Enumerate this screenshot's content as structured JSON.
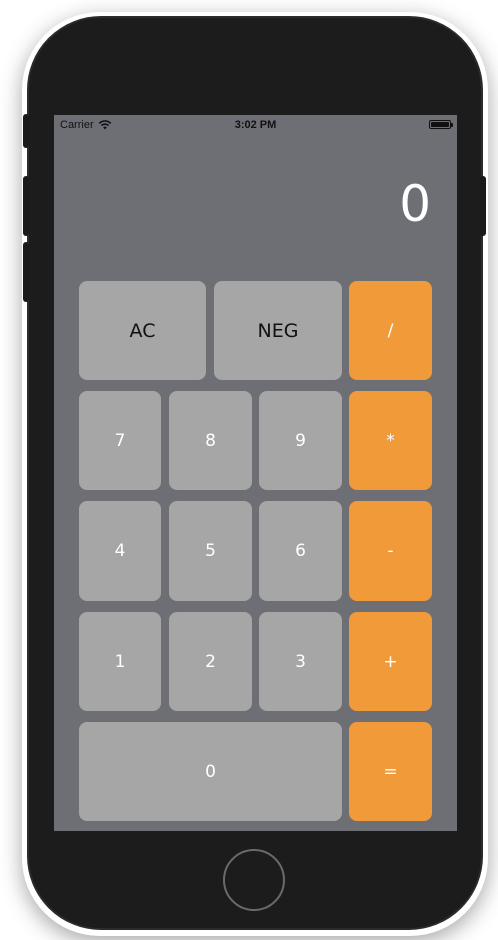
{
  "status_bar": {
    "carrier": "Carrier",
    "time": "3:02 PM",
    "wifi_icon": "wifi-icon",
    "battery_icon": "battery-icon"
  },
  "display": {
    "value": "0"
  },
  "keys": {
    "ac": "AC",
    "neg": "NEG",
    "divide": "/",
    "seven": "7",
    "eight": "8",
    "nine": "9",
    "multiply": "*",
    "four": "4",
    "five": "5",
    "six": "6",
    "subtract": "-",
    "one": "1",
    "two": "2",
    "three": "3",
    "add": "+",
    "zero": "0",
    "equals": "="
  },
  "colors": {
    "screen_background": "#6e6f75",
    "digit_key": "#a6a6a6",
    "operator_key": "#f19a3a",
    "phone_body": "#1c1c1c"
  }
}
